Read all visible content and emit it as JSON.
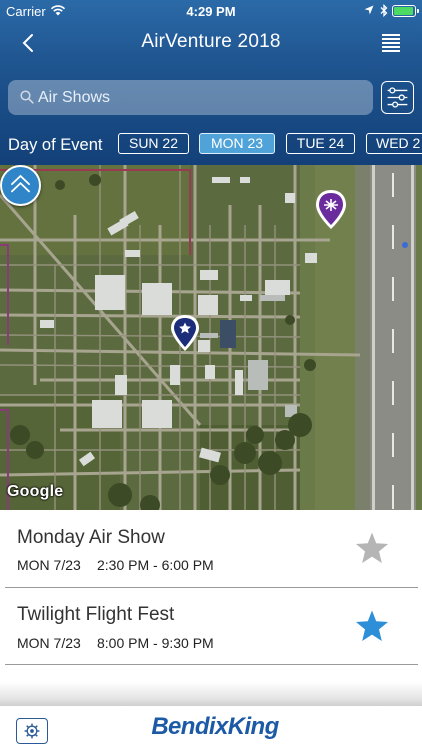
{
  "status_bar": {
    "carrier": "Carrier",
    "time": "4:29 PM",
    "battery_level": 0.85
  },
  "nav": {
    "title": "AirVenture 2018"
  },
  "search": {
    "placeholder": "Air Shows",
    "value": ""
  },
  "day_filter": {
    "label": "Day of Event",
    "days": [
      {
        "label": "SUN 22",
        "selected": false
      },
      {
        "label": "MON 23",
        "selected": true
      },
      {
        "label": "TUE 24",
        "selected": false
      },
      {
        "label": "WED 2",
        "selected": false
      }
    ]
  },
  "map": {
    "attribution": "Google"
  },
  "events": [
    {
      "title": "Monday Air Show",
      "date": "MON 7/23",
      "time": "2:30 PM - 6:00 PM",
      "favorite": false
    },
    {
      "title": "Twilight Flight Fest",
      "date": "MON 7/23",
      "time": "8:00 PM - 9:30 PM",
      "favorite": true
    }
  ],
  "footer": {
    "brand": "BendixKing"
  },
  "colors": {
    "header_top": "#2b6aa8",
    "header_bottom": "#134078",
    "day_selected": "#4fa3d8",
    "star_active": "#2e8fd9",
    "star_inactive": "#b5b5b5",
    "pin_purple": "#6a2c9c",
    "pin_navy": "#1c2e7a",
    "brand_blue": "#1d5aa6"
  }
}
